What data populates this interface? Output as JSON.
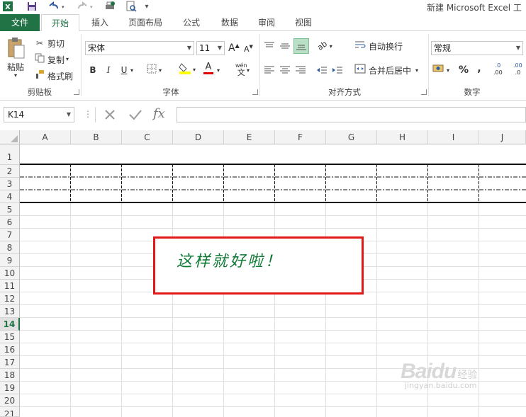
{
  "title_bar": {
    "app_title": "新建 Microsoft Excel 工",
    "quick_access_icons": [
      "excel-logo",
      "save",
      "undo",
      "redo",
      "printer-check",
      "print-preview",
      "customize"
    ]
  },
  "tabs": [
    {
      "label": "文件",
      "active": false
    },
    {
      "label": "开始",
      "active": true
    },
    {
      "label": "插入",
      "active": false
    },
    {
      "label": "页面布局",
      "active": false
    },
    {
      "label": "公式",
      "active": false
    },
    {
      "label": "数据",
      "active": false
    },
    {
      "label": "审阅",
      "active": false
    },
    {
      "label": "视图",
      "active": false
    }
  ],
  "ribbon": {
    "clipboard": {
      "group_label": "剪贴板",
      "paste": "粘贴",
      "cut": "剪切",
      "copy": "复制",
      "format_painter": "格式刷"
    },
    "font": {
      "group_label": "字体",
      "font_name": "宋体",
      "font_size": "11",
      "grow": "A",
      "shrink": "A",
      "bold": "B",
      "italic": "I",
      "underline": "U",
      "font_color_glyph": "A",
      "phonetic": "wén",
      "phonetic_char": "文"
    },
    "alignment": {
      "group_label": "对齐方式",
      "wrap_text": "自动换行",
      "merge_center": "合并后居中"
    },
    "number": {
      "group_label": "数字",
      "format": "常规",
      "percent": "%",
      "comma": ",",
      "inc_decimal": ".00",
      "dec_decimal": ".0"
    }
  },
  "formula_bar": {
    "name_box": "K14",
    "fx": "fx",
    "value": ""
  },
  "grid": {
    "columns": [
      "A",
      "B",
      "C",
      "D",
      "E",
      "F",
      "G",
      "H",
      "I",
      "J"
    ],
    "rows": [
      "1",
      "2",
      "3",
      "4",
      "5",
      "6",
      "7",
      "8",
      "9",
      "10",
      "11",
      "12",
      "13",
      "14",
      "15",
      "16",
      "17",
      "18",
      "19",
      "20",
      "21"
    ],
    "active_row": "14",
    "callout_text": "这样就好啦！"
  },
  "colors": {
    "accent": "#217346",
    "callout_border": "#e11818",
    "callout_text": "#0f7a36"
  },
  "watermark": {
    "brand": "Baidu",
    "brand_sub": "经验",
    "url": "jingyan.baidu.com"
  }
}
